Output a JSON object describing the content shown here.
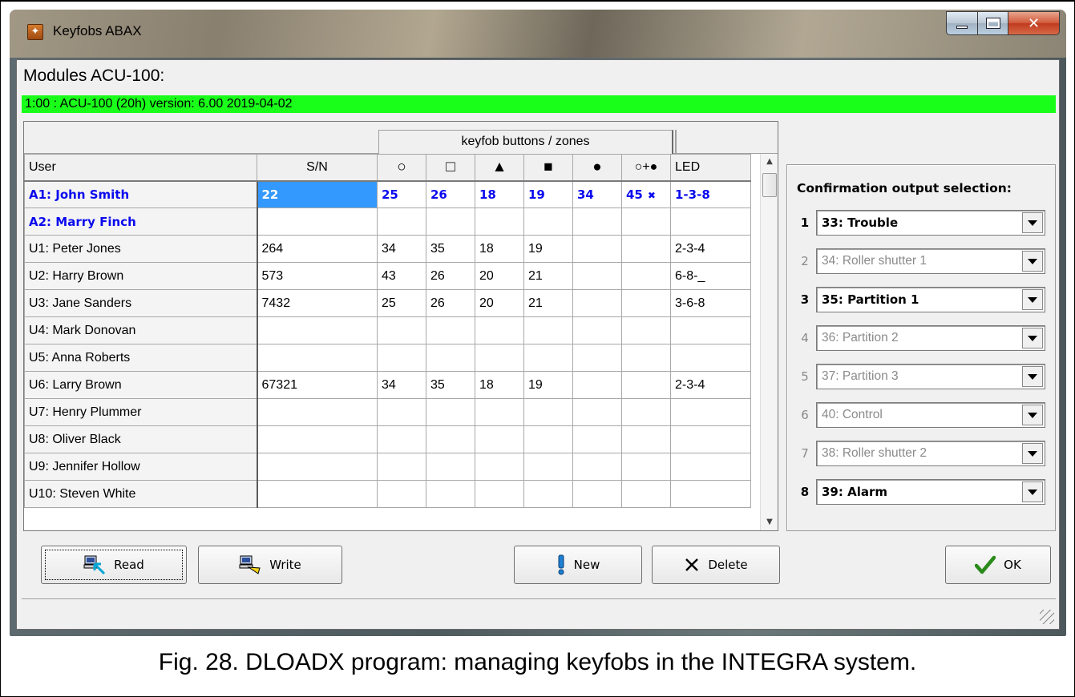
{
  "window": {
    "title": "Keyfobs ABAX"
  },
  "modules": {
    "title": "Modules ACU-100:",
    "item": "1:00 :  ACU-100   (20h) version: 6.00 2019-04-02"
  },
  "grid": {
    "group_header": "keyfob buttons / zones",
    "columns": [
      "User",
      "S/N",
      "○",
      "□",
      "▲",
      "■",
      "●",
      "○+●",
      "LED"
    ],
    "rows": [
      {
        "user": "A1: John Smith",
        "sn": "22",
        "b1": "25",
        "b2": "26",
        "b3": "18",
        "b4": "19",
        "b5": "34",
        "b6": "45",
        "b6_flag": "✖",
        "led": "1-3-8"
      },
      {
        "user": "A2: Marry Finch",
        "sn": "",
        "b1": "",
        "b2": "",
        "b3": "",
        "b4": "",
        "b5": "",
        "b6": "",
        "b6_flag": "",
        "led": ""
      },
      {
        "user": "U1: Peter Jones",
        "sn": "264",
        "b1": "34",
        "b2": "35",
        "b3": "18",
        "b4": "19",
        "b5": "",
        "b6": "",
        "b6_flag": "",
        "led": "2-3-4"
      },
      {
        "user": "U2: Harry Brown",
        "sn": "573",
        "b1": "43",
        "b2": "26",
        "b3": "20",
        "b4": "21",
        "b5": "",
        "b6": "",
        "b6_flag": "",
        "led": "6-8-_"
      },
      {
        "user": "U3: Jane Sanders",
        "sn": "7432",
        "b1": "25",
        "b2": "26",
        "b3": "20",
        "b4": "21",
        "b5": "",
        "b6": "",
        "b6_flag": "",
        "led": "3-6-8"
      },
      {
        "user": "U4: Mark Donovan",
        "sn": "",
        "b1": "",
        "b2": "",
        "b3": "",
        "b4": "",
        "b5": "",
        "b6": "",
        "b6_flag": "",
        "led": ""
      },
      {
        "user": "U5: Anna Roberts",
        "sn": "",
        "b1": "",
        "b2": "",
        "b3": "",
        "b4": "",
        "b5": "",
        "b6": "",
        "b6_flag": "",
        "led": ""
      },
      {
        "user": "U6: Larry Brown",
        "sn": "67321",
        "b1": "34",
        "b2": "35",
        "b3": "18",
        "b4": "19",
        "b5": "",
        "b6": "",
        "b6_flag": "",
        "led": "2-3-4"
      },
      {
        "user": "U7: Henry Plummer",
        "sn": "",
        "b1": "",
        "b2": "",
        "b3": "",
        "b4": "",
        "b5": "",
        "b6": "",
        "b6_flag": "",
        "led": ""
      },
      {
        "user": "U8: Oliver Black",
        "sn": "",
        "b1": "",
        "b2": "",
        "b3": "",
        "b4": "",
        "b5": "",
        "b6": "",
        "b6_flag": "",
        "led": ""
      },
      {
        "user": "U9: Jennifer Hollow",
        "sn": "",
        "b1": "",
        "b2": "",
        "b3": "",
        "b4": "",
        "b5": "",
        "b6": "",
        "b6_flag": "",
        "led": ""
      },
      {
        "user": "U10: Steven White",
        "sn": "",
        "b1": "",
        "b2": "",
        "b3": "",
        "b4": "",
        "b5": "",
        "b6": "",
        "b6_flag": "",
        "led": ""
      }
    ]
  },
  "confirmation": {
    "title": "Confirmation output selection:",
    "options": [
      {
        "num": "1",
        "value": "33: Trouble",
        "enabled": true
      },
      {
        "num": "2",
        "value": "34: Roller shutter 1",
        "enabled": false
      },
      {
        "num": "3",
        "value": "35: Partition 1",
        "enabled": true
      },
      {
        "num": "4",
        "value": "36: Partition 2",
        "enabled": false
      },
      {
        "num": "5",
        "value": "37: Partition 3",
        "enabled": false
      },
      {
        "num": "6",
        "value": "40: Control",
        "enabled": false
      },
      {
        "num": "7",
        "value": "38: Roller shutter 2",
        "enabled": false
      },
      {
        "num": "8",
        "value": "39: Alarm",
        "enabled": true
      }
    ]
  },
  "buttons": {
    "read": "Read",
    "write": "Write",
    "new": "New",
    "delete": "Delete",
    "ok": "OK"
  },
  "colors": {
    "module_bar": "#19ff19",
    "admin_text": "#0a0aee",
    "selection": "#3399ff",
    "ok_check": "#2a8a1a"
  },
  "caption": "Fig. 28. DLOADX program: managing keyfobs in the INTEGRA system."
}
